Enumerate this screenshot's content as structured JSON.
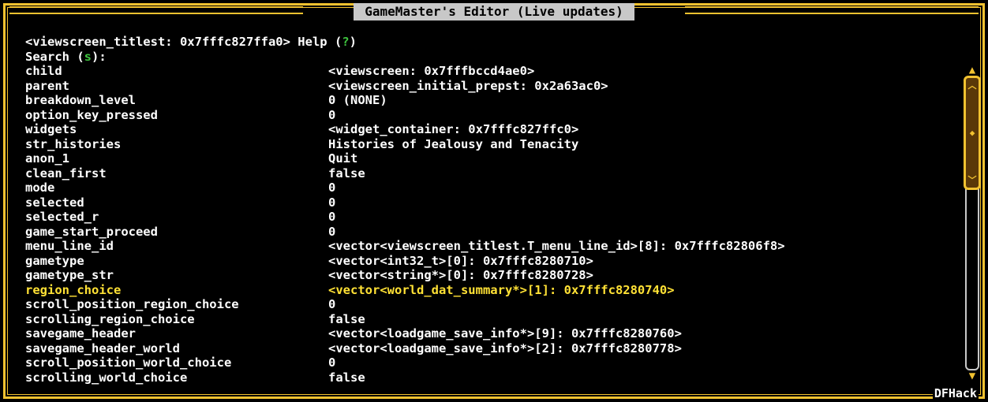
{
  "window": {
    "title": "GameMaster's Editor (Live updates)",
    "brand": "DFHack"
  },
  "header": {
    "object": "<viewscreen_titlest: 0x7fffc827ffa0>",
    "help_label": "Help (",
    "help_key": "?",
    "help_close": ")",
    "search_label": "Search (",
    "search_key": "s",
    "search_close": "):"
  },
  "fields": [
    {
      "name": "child",
      "value": "<viewscreen: 0x7fffbccd4ae0>"
    },
    {
      "name": "parent",
      "value": "<viewscreen_initial_prepst: 0x2a63ac0>"
    },
    {
      "name": "breakdown_level",
      "value": "0 (NONE)"
    },
    {
      "name": "option_key_pressed",
      "value": "0"
    },
    {
      "name": "widgets",
      "value": "<widget_container: 0x7fffc827ffc0>"
    },
    {
      "name": "str_histories",
      "value": "Histories of Jealousy and Tenacity"
    },
    {
      "name": "anon_1",
      "value": "Quit"
    },
    {
      "name": "clean_first",
      "value": "false"
    },
    {
      "name": "mode",
      "value": "0"
    },
    {
      "name": "selected",
      "value": "0"
    },
    {
      "name": "selected_r",
      "value": "0"
    },
    {
      "name": "game_start_proceed",
      "value": "0"
    },
    {
      "name": "menu_line_id",
      "value": "<vector<viewscreen_titlest.T_menu_line_id>[8]: 0x7fffc82806f8>"
    },
    {
      "name": "gametype",
      "value": "<vector<int32_t>[0]: 0x7fffc8280710>"
    },
    {
      "name": "gametype_str",
      "value": "<vector<string*>[0]: 0x7fffc8280728>"
    },
    {
      "name": "region_choice",
      "value": "<vector<world_dat_summary*>[1]: 0x7fffc8280740>",
      "selected": true
    },
    {
      "name": "scroll_position_region_choice",
      "value": "0"
    },
    {
      "name": "scrolling_region_choice",
      "value": "false"
    },
    {
      "name": "savegame_header",
      "value": "<vector<loadgame_save_info*>[9]: 0x7fffc8280760>"
    },
    {
      "name": "savegame_header_world",
      "value": "<vector<loadgame_save_info*>[2]: 0x7fffc8280778>"
    },
    {
      "name": "scroll_position_world_choice",
      "value": "0"
    },
    {
      "name": "scrolling_world_choice",
      "value": "false"
    }
  ],
  "colors": {
    "frame": "#f2c230",
    "hotkey": "#3ec23e",
    "highlight": "#ffe135",
    "title_bg": "#c8c8c8"
  }
}
